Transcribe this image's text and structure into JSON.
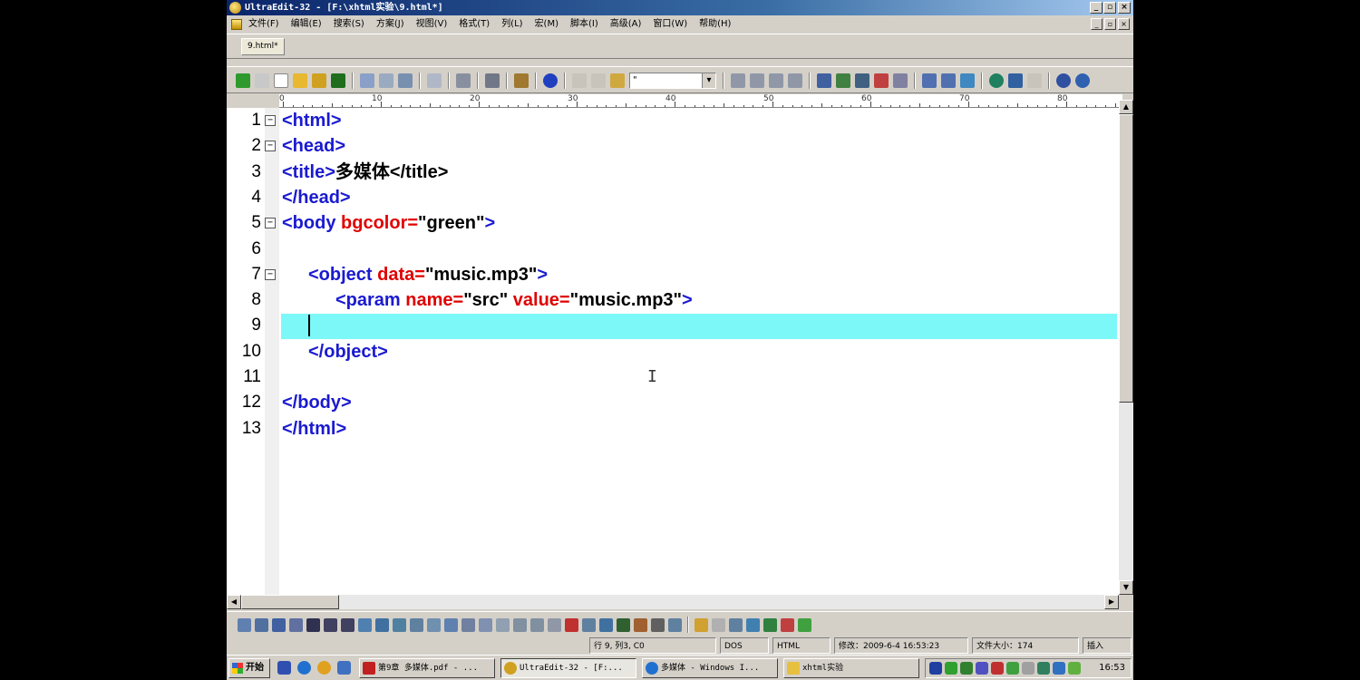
{
  "window": {
    "title": "UltraEdit-32 - [F:\\xhtml实验\\9.html*]",
    "controls": {
      "minimize": "_",
      "maximize": "▫",
      "close": "×"
    }
  },
  "menu": {
    "items": [
      "文件(F)",
      "编辑(E)",
      "搜索(S)",
      "方案(J)",
      "视图(V)",
      "格式(T)",
      "列(L)",
      "宏(M)",
      "脚本(I)",
      "高级(A)",
      "窗口(W)",
      "帮助(H)"
    ],
    "mdi": {
      "minimize": "_",
      "restore": "▫",
      "close": "×"
    }
  },
  "tabs": [
    {
      "label": "9.html*",
      "active": true
    }
  ],
  "toolbar": {
    "font_combo_value": "\""
  },
  "ruler": {
    "labels": [
      "0",
      "10",
      "20",
      "30",
      "40",
      "50",
      "60",
      "70",
      "80"
    ]
  },
  "editor": {
    "lines": [
      {
        "num": "1",
        "fold": "−",
        "indent": 0,
        "tokens": [
          {
            "t": "tag",
            "s": "<html>"
          }
        ]
      },
      {
        "num": "2",
        "fold": "−",
        "indent": 0,
        "tokens": [
          {
            "t": "tag",
            "s": "<head>"
          }
        ]
      },
      {
        "num": "3",
        "fold": "",
        "indent": 0,
        "tokens": [
          {
            "t": "tag",
            "s": "<title>"
          },
          {
            "t": "txt",
            "s": "多媒体"
          },
          {
            "t": "txt",
            "s": "</title>"
          }
        ]
      },
      {
        "num": "4",
        "fold": "",
        "indent": 0,
        "tokens": [
          {
            "t": "tag",
            "s": "</head>"
          }
        ]
      },
      {
        "num": "5",
        "fold": "−",
        "indent": 0,
        "tokens": [
          {
            "t": "tag",
            "s": "<body "
          },
          {
            "t": "attr",
            "s": "bgcolor="
          },
          {
            "t": "val",
            "s": "\"green\""
          },
          {
            "t": "tag",
            "s": ">"
          }
        ]
      },
      {
        "num": "6",
        "fold": "",
        "indent": 0,
        "tokens": []
      },
      {
        "num": "7",
        "fold": "−",
        "indent": 1,
        "tokens": [
          {
            "t": "tag",
            "s": "<object "
          },
          {
            "t": "attr",
            "s": "data="
          },
          {
            "t": "val",
            "s": "\"music.mp3\""
          },
          {
            "t": "tag",
            "s": ">"
          }
        ]
      },
      {
        "num": "8",
        "fold": "",
        "indent": 2,
        "tokens": [
          {
            "t": "tag",
            "s": "<param "
          },
          {
            "t": "attr",
            "s": "name="
          },
          {
            "t": "val",
            "s": "\"src\" "
          },
          {
            "t": "attr",
            "s": "value="
          },
          {
            "t": "val",
            "s": "\"music.mp3\""
          },
          {
            "t": "tag",
            "s": ">"
          }
        ]
      },
      {
        "num": "9",
        "fold": "",
        "indent": 1,
        "tokens": [],
        "highlight": true,
        "caret": true
      },
      {
        "num": "10",
        "fold": "",
        "indent": 1,
        "tokens": [
          {
            "t": "tag",
            "s": "</object>"
          }
        ]
      },
      {
        "num": "11",
        "fold": "",
        "indent": 0,
        "tokens": []
      },
      {
        "num": "12",
        "fold": "",
        "indent": 0,
        "tokens": [
          {
            "t": "tag",
            "s": "</body>"
          }
        ]
      },
      {
        "num": "13",
        "fold": "",
        "indent": 0,
        "tokens": [
          {
            "t": "tag",
            "s": "</html>"
          }
        ]
      }
    ],
    "colors": {
      "tag": "#1a1ad0",
      "attr": "#e00000",
      "text": "#000000",
      "current_line": "#7df8f8"
    }
  },
  "status": {
    "position": "行 9, 列3, C0",
    "line_ending": "DOS",
    "syntax": "HTML",
    "modified": "修改：2009-6-4 16:53:23",
    "file_size": "文件大小：174",
    "insert_mode": "插入"
  },
  "taskbar": {
    "start_label": "开始",
    "tasks": [
      {
        "label": "第9章 多媒体.pdf - ...",
        "active": false,
        "icon": "pdf-icon"
      },
      {
        "label": "UltraEdit-32 - [F:...",
        "active": true,
        "icon": "ultraedit-icon"
      },
      {
        "label": "多媒体 - Windows I...",
        "active": false,
        "icon": "ie-icon"
      },
      {
        "label": "xhtml实验",
        "active": false,
        "icon": "folder-icon"
      }
    ],
    "clock": "16:53"
  }
}
